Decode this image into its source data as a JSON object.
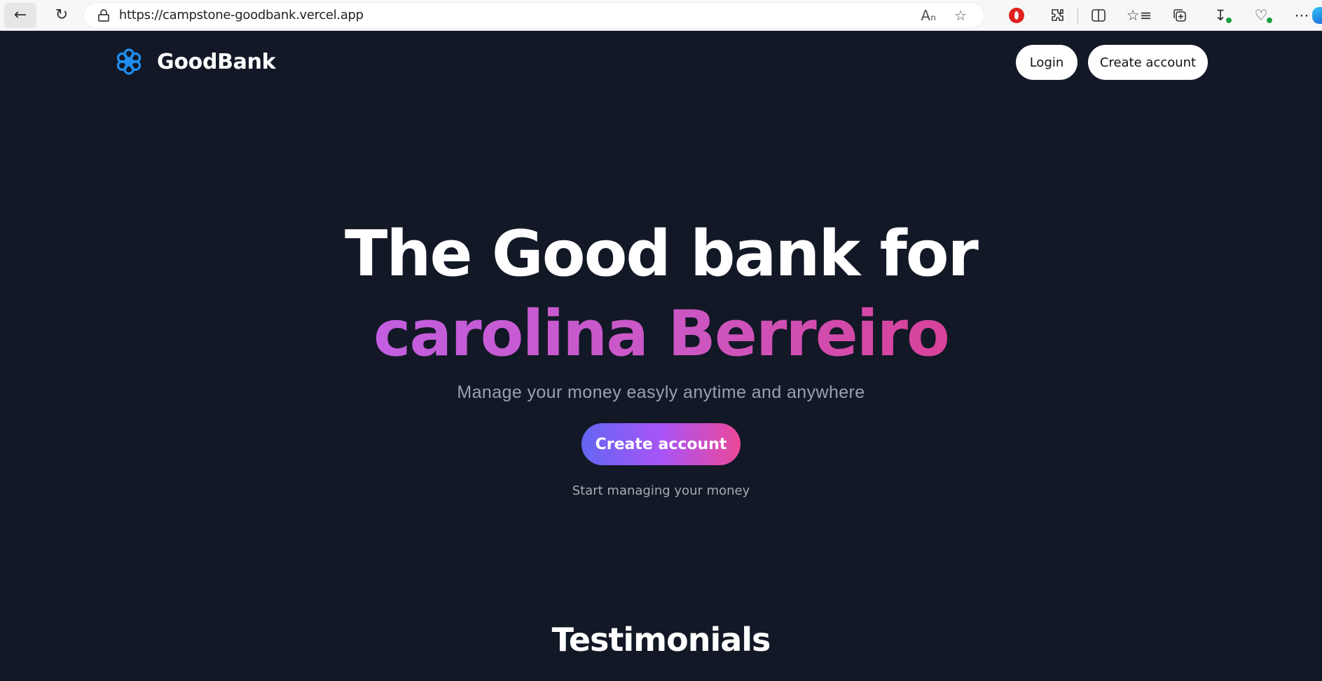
{
  "browser": {
    "url": "https://campstone-goodbank.vercel.app",
    "icons": [
      "back-arrow-icon",
      "reload-icon",
      "lock-icon",
      "read-aloud-icon",
      "favorite-star-icon",
      "opera-icon",
      "extensions-icon",
      "split-screen-icon",
      "favorites-icon",
      "collections-icon",
      "downloads-icon",
      "health-icon",
      "more-icon",
      "copilot-icon"
    ]
  },
  "navbar": {
    "brand": "GoodBank",
    "login_label": "Login",
    "create_account_label": "Create account"
  },
  "hero": {
    "headline": "The Good bank for",
    "name": "carolina Berreiro",
    "subtitle": "Manage your money easyly anytime and anywhere",
    "cta_label": "Create account",
    "cta_caption": "Start managing your money"
  },
  "testimonials": {
    "title": "Testimonials"
  },
  "colors": {
    "page_background": "#121826",
    "logo_blue": "#1e8ff0",
    "gradient_start": "#6366f1",
    "gradient_mid": "#a855f7",
    "gradient_end": "#ec4899",
    "name_gradient_start": "#c25ee0",
    "name_gradient_end": "#d8429a"
  }
}
